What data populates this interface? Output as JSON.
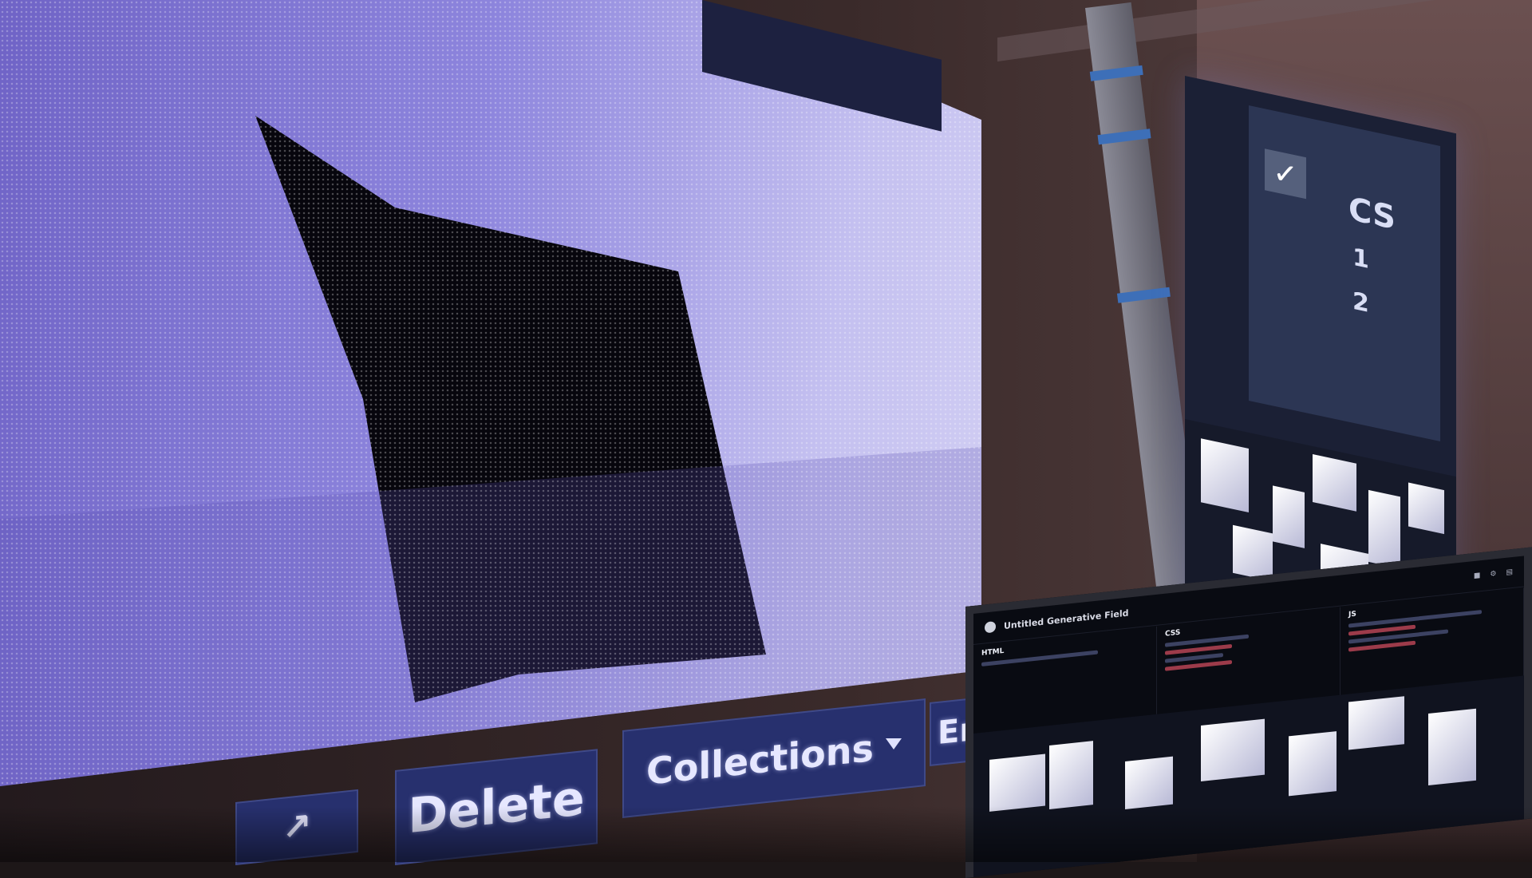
{
  "scene": {
    "background_color": "#1d1718",
    "led_color": "#8d85dd"
  },
  "led_toolbar": {
    "icon": "external-link-icon",
    "delete_label": "Delete",
    "collections_label": "Collections",
    "collections_caret": "chevron-down-icon",
    "em_label": "Em"
  },
  "tower": {
    "check_icon": "checkmark-icon",
    "cs_label": "CS",
    "num_1": "1",
    "num_2": "2"
  },
  "laptop": {
    "window_title": "Untitled Generative Field",
    "html_label": "HTML",
    "css_label": "CSS",
    "js_label": "JS"
  }
}
